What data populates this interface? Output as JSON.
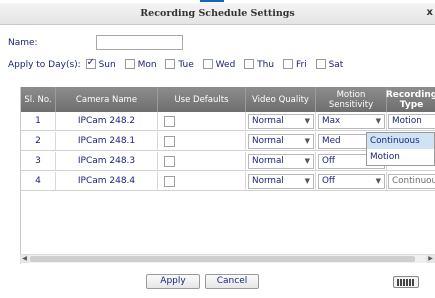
{
  "dialog": {
    "title": "Recording Schedule Settings",
    "close_label": "x"
  },
  "form": {
    "name_label": "Name:",
    "name_value": "",
    "apply_days_label": "Apply to Day(s):",
    "days": [
      {
        "label": "Sun",
        "checked": true
      },
      {
        "label": "Mon",
        "checked": false
      },
      {
        "label": "Tue",
        "checked": false
      },
      {
        "label": "Wed",
        "checked": false
      },
      {
        "label": "Thu",
        "checked": false
      },
      {
        "label": "Fri",
        "checked": false
      },
      {
        "label": "Sat",
        "checked": false
      }
    ]
  },
  "table": {
    "headers": [
      "Sl. No.",
      "Camera Name",
      "Use Defaults",
      "Video Quality",
      "Motion Sensitivity",
      "Recording Type"
    ],
    "rows": [
      {
        "slno": "1",
        "camera": "IPCam 248.2",
        "use_defaults": false,
        "quality": "Normal",
        "sensitivity": "Max",
        "type": "Motion"
      },
      {
        "slno": "2",
        "camera": "IPCam 248.1",
        "use_defaults": false,
        "quality": "Normal",
        "sensitivity": "Med",
        "type": ""
      },
      {
        "slno": "3",
        "camera": "IPCam 248.3",
        "use_defaults": false,
        "quality": "Normal",
        "sensitivity": "Off",
        "type": ""
      },
      {
        "slno": "4",
        "camera": "IPCam 248.4",
        "use_defaults": false,
        "quality": "Normal",
        "sensitivity": "Off",
        "type": "Continuous"
      }
    ],
    "type_dropdown": {
      "options": [
        "Continuous",
        "Motion"
      ],
      "highlighted": "Continuous"
    }
  },
  "buttons": {
    "apply": "Apply",
    "cancel": "Cancel"
  },
  "icons": {
    "keyboard": "keyboard-icon",
    "dropdown_arrow": "chevron-down-icon",
    "close": "close-icon"
  },
  "colors": {
    "text": "#1a237e",
    "header_bg": "#7a7a7a",
    "highlight": "#cfe3f5"
  }
}
